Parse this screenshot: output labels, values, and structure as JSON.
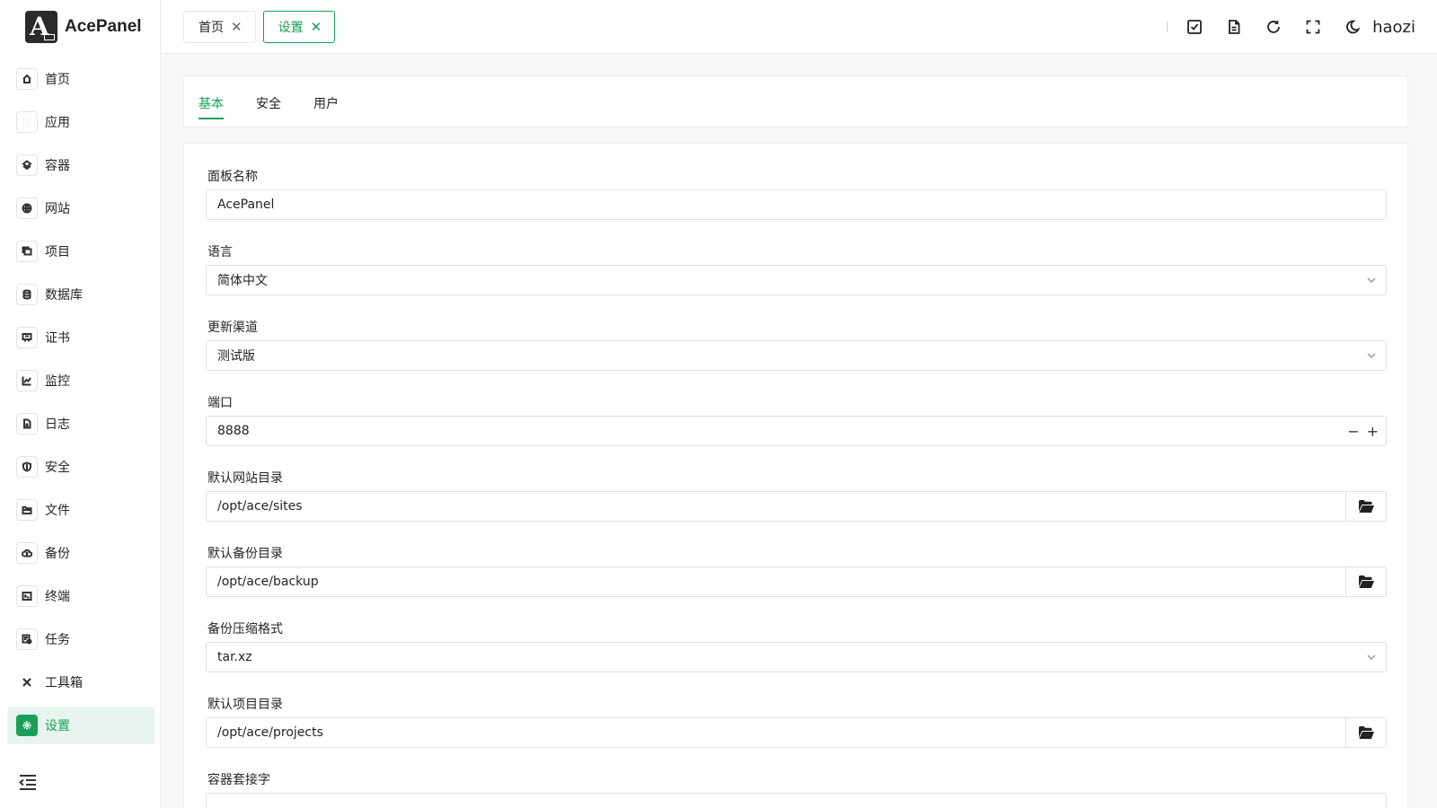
{
  "brand": {
    "name": "AcePanel"
  },
  "sidebar": {
    "items": [
      {
        "label": "首页",
        "icon": "home-icon"
      },
      {
        "label": "应用",
        "icon": "apps-grid-icon"
      },
      {
        "label": "容器",
        "icon": "container-layers-icon"
      },
      {
        "label": "网站",
        "icon": "globe-icon"
      },
      {
        "label": "项目",
        "icon": "project-icon"
      },
      {
        "label": "数据库",
        "icon": "database-icon"
      },
      {
        "label": "证书",
        "icon": "certificate-icon"
      },
      {
        "label": "监控",
        "icon": "chart-line-icon"
      },
      {
        "label": "日志",
        "icon": "log-file-icon"
      },
      {
        "label": "安全",
        "icon": "shield-icon"
      },
      {
        "label": "文件",
        "icon": "folder-icon"
      },
      {
        "label": "备份",
        "icon": "cloud-backup-icon"
      },
      {
        "label": "终端",
        "icon": "terminal-icon"
      },
      {
        "label": "任务",
        "icon": "task-icon"
      },
      {
        "label": "工具箱",
        "icon": "tools-icon"
      },
      {
        "label": "设置",
        "icon": "gear-icon",
        "active": true
      }
    ]
  },
  "header": {
    "tabs": [
      {
        "label": "首页"
      },
      {
        "label": "设置",
        "active": true
      }
    ],
    "username": "haozi"
  },
  "subtabs": [
    {
      "label": "基本",
      "active": true
    },
    {
      "label": "安全"
    },
    {
      "label": "用户"
    }
  ],
  "form": {
    "panel_name": {
      "label": "面板名称",
      "value": "AcePanel"
    },
    "language": {
      "label": "语言",
      "value": "简体中文"
    },
    "channel": {
      "label": "更新渠道",
      "value": "测试版"
    },
    "port": {
      "label": "端口",
      "value": "8888"
    },
    "website_dir": {
      "label": "默认网站目录",
      "value": "/opt/ace/sites"
    },
    "backup_dir": {
      "label": "默认备份目录",
      "value": "/opt/ace/backup"
    },
    "compress_format": {
      "label": "备份压缩格式",
      "value": "tar.xz"
    },
    "project_dir": {
      "label": "默认项目目录",
      "value": "/opt/ace/projects"
    },
    "container_socket": {
      "label": "容器套接字"
    }
  },
  "colors": {
    "accent": "#18a058",
    "accent_bg": "#e7f5ee"
  }
}
